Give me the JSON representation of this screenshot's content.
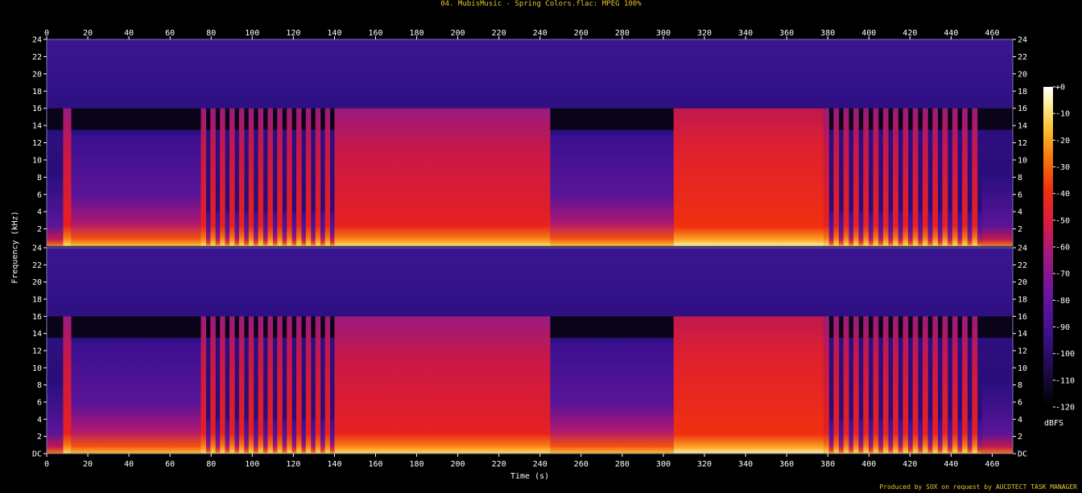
{
  "title": "04. MubisMusic - Spring Colors.flac: MPEG 100%",
  "credit": "Produced by SOX on request by AUCDTECT TASK MANAGER",
  "chart_data": {
    "type": "heatmap",
    "xlabel": "Time (s)",
    "ylabel": "Frequency (kHz)",
    "xlim": [
      0,
      470
    ],
    "ylim": [
      0,
      24
    ],
    "x_ticks": [
      0,
      20,
      40,
      60,
      80,
      100,
      120,
      140,
      160,
      180,
      200,
      220,
      240,
      260,
      280,
      300,
      320,
      340,
      360,
      380,
      400,
      420,
      440,
      460
    ],
    "y_tick_labels": [
      "DC",
      "2",
      "4",
      "6",
      "8",
      "10",
      "12",
      "14",
      "16",
      "18",
      "20",
      "22",
      "24"
    ],
    "channels": 2,
    "lowpass_cutoff_khz": 16,
    "colorbar": {
      "label": "dBFS",
      "range": [
        -120,
        0
      ],
      "tick_labels": [
        "+0",
        "-10",
        "-20",
        "-30",
        "-40",
        "-50",
        "-60",
        "-70",
        "-80",
        "-90",
        "-100",
        "-110",
        "-120"
      ],
      "colors": [
        "#000000",
        "#1a0a40",
        "#3a108a",
        "#6a14a0",
        "#a01880",
        "#d81c40",
        "#f0300c",
        "#f87810",
        "#fcc030",
        "#fff0a0",
        "#ffffff"
      ]
    },
    "sections": [
      {
        "start": 0,
        "end": 8,
        "level": "quiet"
      },
      {
        "start": 8,
        "end": 12,
        "level": "loud"
      },
      {
        "start": 12,
        "end": 75,
        "level": "medium"
      },
      {
        "start": 75,
        "end": 140,
        "level": "pulsing"
      },
      {
        "start": 140,
        "end": 245,
        "level": "loud"
      },
      {
        "start": 245,
        "end": 305,
        "level": "medium"
      },
      {
        "start": 305,
        "end": 378,
        "level": "very-loud"
      },
      {
        "start": 378,
        "end": 455,
        "level": "pulsing"
      },
      {
        "start": 455,
        "end": 470,
        "level": "fade"
      }
    ]
  }
}
